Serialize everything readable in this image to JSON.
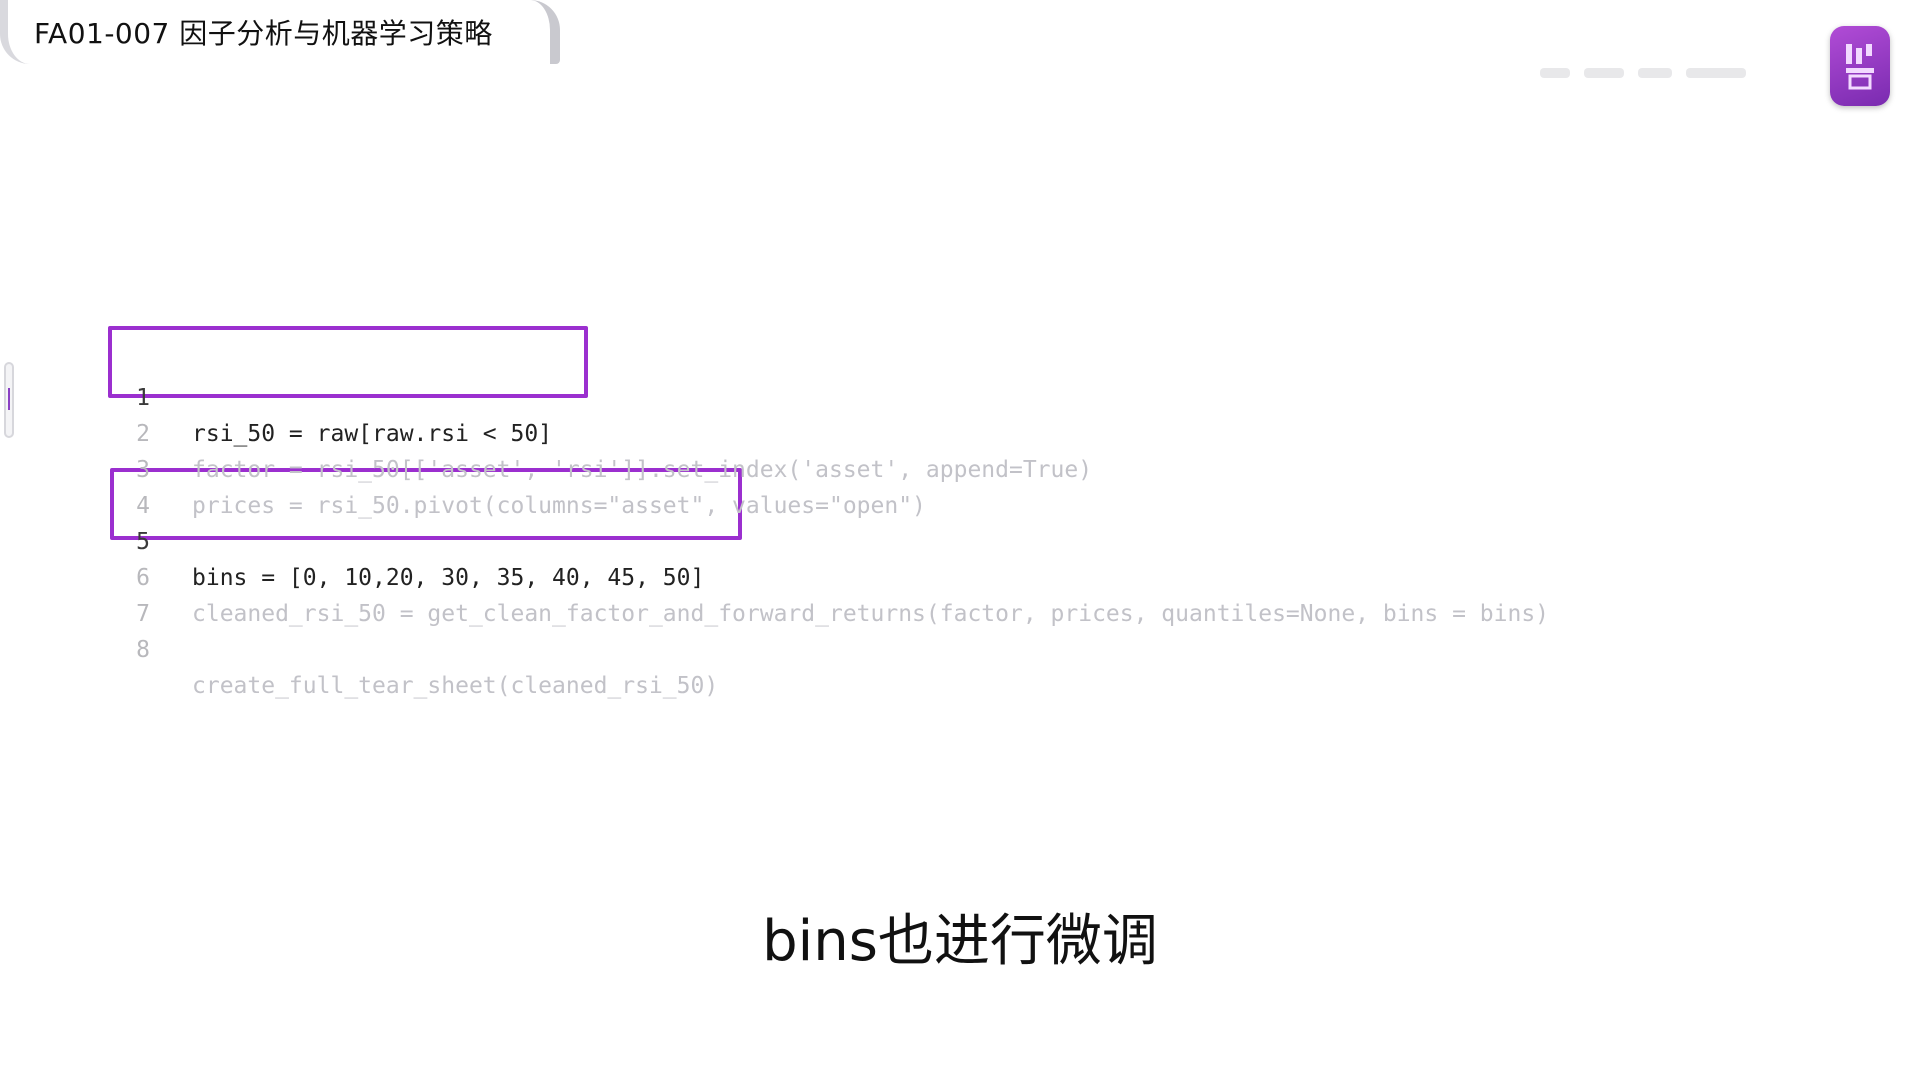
{
  "header": {
    "title": "FA01-007 因子分析与机器学习策略"
  },
  "logo": {
    "icon": "brand-badge-icon",
    "color": "#9b2fcf"
  },
  "code": {
    "highlight_color": "#9b2fcf",
    "lines": [
      {
        "num": "1",
        "text": "rsi_50 = raw[raw.rsi < 50]"
      },
      {
        "num": "2",
        "text": "factor = rsi_50[['asset', 'rsi']].set_index('asset', append=True)"
      },
      {
        "num": "3",
        "text": "prices = rsi_50.pivot(columns=\"asset\", values=\"open\")"
      },
      {
        "num": "4",
        "text": ""
      },
      {
        "num": "5",
        "text": "bins = [0, 10,20, 30, 35, 40, 45, 50]"
      },
      {
        "num": "6",
        "text": "cleaned_rsi_50 = get_clean_factor_and_forward_returns(factor, prices, quantiles=None, bins = bins)"
      },
      {
        "num": "7",
        "text": ""
      },
      {
        "num": "8",
        "text": "create_full_tear_sheet(cleaned_rsi_50)"
      }
    ]
  },
  "subtitle": {
    "text": "bins也进行微调"
  }
}
